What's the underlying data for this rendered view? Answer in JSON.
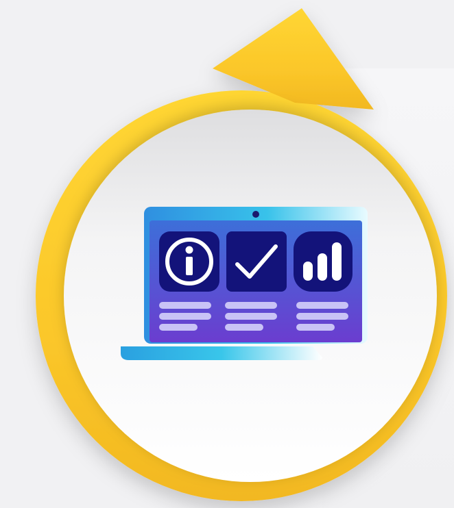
{
  "colors": {
    "background": "#f1f1f3",
    "badge_yellow": "#ffd22e",
    "badge_yellow_dark": "#f2b820",
    "inner_disc_top": "#e4e4e6",
    "inner_disc_bottom": "#ffffff",
    "screen_frame_top": "#3aa6e6",
    "screen_frame_bottom": "#2fbce8",
    "screen_top": "#3f6fd8",
    "screen_bottom": "#6a3fd0",
    "tile": "#13137a",
    "line_lavender": "#c9c3f6",
    "icon_white": "#ffffff",
    "camera_dot": "#1a1a6e"
  },
  "icons": {
    "info": "info-icon",
    "check": "checkmark-icon",
    "bars": "bar-chart-icon"
  }
}
